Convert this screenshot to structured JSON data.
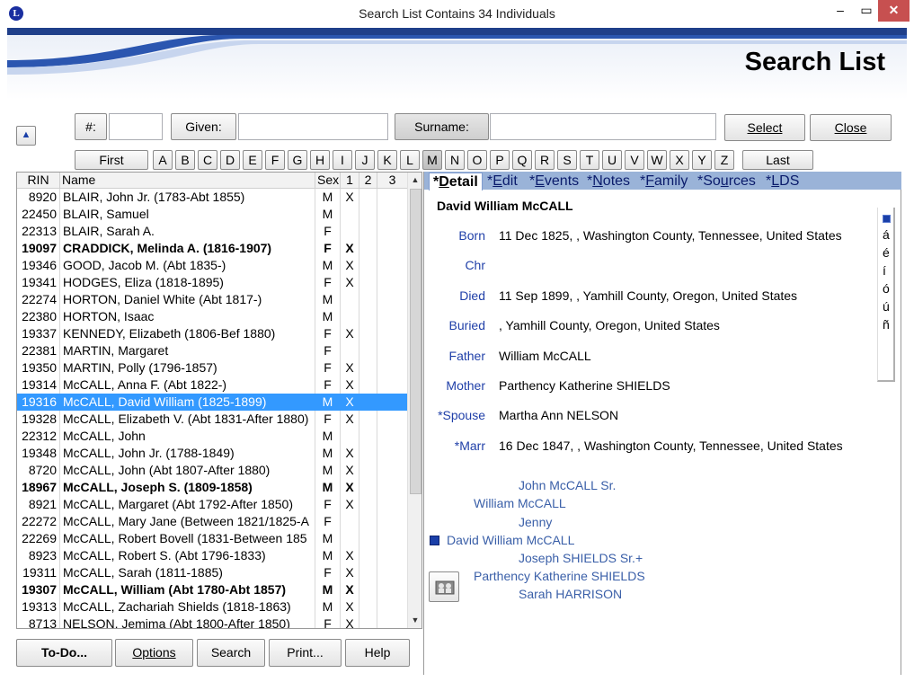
{
  "window": {
    "title": "Search List Contains 34 Individuals",
    "app_icon_letter": "L",
    "minimize_glyph": "–",
    "maximize_glyph": "▭",
    "close_glyph": "✕"
  },
  "header": {
    "title": "Search List"
  },
  "search": {
    "scroll_up_glyph": "▲",
    "num_label": "#:",
    "num_value": "",
    "given_label": "Given:",
    "given_value": "",
    "surname_label": "Surname:",
    "surname_value": "",
    "select_label": "Select",
    "close_label": "Close"
  },
  "alphabet": {
    "first_label": "First",
    "last_label": "Last",
    "letters": [
      "A",
      "B",
      "C",
      "D",
      "E",
      "F",
      "G",
      "H",
      "I",
      "J",
      "K",
      "L",
      "M",
      "N",
      "O",
      "P",
      "Q",
      "R",
      "S",
      "T",
      "U",
      "V",
      "W",
      "X",
      "Y",
      "Z"
    ],
    "active_letter": "M"
  },
  "list": {
    "columns": [
      "RIN",
      "Name",
      "Sex",
      "1",
      "2",
      "3"
    ],
    "rows": [
      {
        "rin": "8920",
        "name": "BLAIR, John Jr. (1783-Abt 1855)",
        "sex": "M",
        "c1": "X",
        "c2": "",
        "c3": "",
        "bold": false,
        "selected": false
      },
      {
        "rin": "22450",
        "name": "BLAIR, Samuel",
        "sex": "M",
        "c1": "",
        "c2": "",
        "c3": "",
        "bold": false,
        "selected": false
      },
      {
        "rin": "22313",
        "name": "BLAIR, Sarah A.",
        "sex": "F",
        "c1": "",
        "c2": "",
        "c3": "",
        "bold": false,
        "selected": false
      },
      {
        "rin": "19097",
        "name": "CRADDICK, Melinda A. (1816-1907)",
        "sex": "F",
        "c1": "X",
        "c2": "",
        "c3": "",
        "bold": true,
        "selected": false
      },
      {
        "rin": "19346",
        "name": "GOOD, Jacob M. (Abt 1835-)",
        "sex": "M",
        "c1": "X",
        "c2": "",
        "c3": "",
        "bold": false,
        "selected": false
      },
      {
        "rin": "19341",
        "name": "HODGES, Eliza (1818-1895)",
        "sex": "F",
        "c1": "X",
        "c2": "",
        "c3": "",
        "bold": false,
        "selected": false
      },
      {
        "rin": "22274",
        "name": "HORTON, Daniel White (Abt 1817-)",
        "sex": "M",
        "c1": "",
        "c2": "",
        "c3": "",
        "bold": false,
        "selected": false
      },
      {
        "rin": "22380",
        "name": "HORTON, Isaac",
        "sex": "M",
        "c1": "",
        "c2": "",
        "c3": "",
        "bold": false,
        "selected": false
      },
      {
        "rin": "19337",
        "name": "KENNEDY, Elizabeth (1806-Bef 1880)",
        "sex": "F",
        "c1": "X",
        "c2": "",
        "c3": "",
        "bold": false,
        "selected": false
      },
      {
        "rin": "22381",
        "name": "MARTIN, Margaret",
        "sex": "F",
        "c1": "",
        "c2": "",
        "c3": "",
        "bold": false,
        "selected": false
      },
      {
        "rin": "19350",
        "name": "MARTIN, Polly (1796-1857)",
        "sex": "F",
        "c1": "X",
        "c2": "",
        "c3": "",
        "bold": false,
        "selected": false
      },
      {
        "rin": "19314",
        "name": "McCALL, Anna F. (Abt 1822-)",
        "sex": "F",
        "c1": "X",
        "c2": "",
        "c3": "",
        "bold": false,
        "selected": false
      },
      {
        "rin": "19316",
        "name": "McCALL, David William (1825-1899)",
        "sex": "M",
        "c1": "X",
        "c2": "",
        "c3": "",
        "bold": false,
        "selected": true
      },
      {
        "rin": "19328",
        "name": "McCALL, Elizabeth V. (Abt 1831-After 1880)",
        "sex": "F",
        "c1": "X",
        "c2": "",
        "c3": "",
        "bold": false,
        "selected": false
      },
      {
        "rin": "22312",
        "name": "McCALL, John",
        "sex": "M",
        "c1": "",
        "c2": "",
        "c3": "",
        "bold": false,
        "selected": false
      },
      {
        "rin": "19348",
        "name": "McCALL, John Jr. (1788-1849)",
        "sex": "M",
        "c1": "X",
        "c2": "",
        "c3": "",
        "bold": false,
        "selected": false
      },
      {
        "rin": "8720",
        "name": "McCALL, John (Abt 1807-After 1880)",
        "sex": "M",
        "c1": "X",
        "c2": "",
        "c3": "",
        "bold": false,
        "selected": false
      },
      {
        "rin": "18967",
        "name": "McCALL, Joseph S. (1809-1858)",
        "sex": "M",
        "c1": "X",
        "c2": "",
        "c3": "",
        "bold": true,
        "selected": false
      },
      {
        "rin": "8921",
        "name": "McCALL, Margaret (Abt 1792-After 1850)",
        "sex": "F",
        "c1": "X",
        "c2": "",
        "c3": "",
        "bold": false,
        "selected": false
      },
      {
        "rin": "22272",
        "name": "McCALL, Mary Jane (Between 1821/1825-A",
        "sex": "F",
        "c1": "",
        "c2": "",
        "c3": "",
        "bold": false,
        "selected": false
      },
      {
        "rin": "22269",
        "name": "McCALL, Robert Bovell (1831-Between 185",
        "sex": "M",
        "c1": "",
        "c2": "",
        "c3": "",
        "bold": false,
        "selected": false
      },
      {
        "rin": "8923",
        "name": "McCALL, Robert S. (Abt 1796-1833)",
        "sex": "M",
        "c1": "X",
        "c2": "",
        "c3": "",
        "bold": false,
        "selected": false
      },
      {
        "rin": "19311",
        "name": "McCALL, Sarah (1811-1885)",
        "sex": "F",
        "c1": "X",
        "c2": "",
        "c3": "",
        "bold": false,
        "selected": false
      },
      {
        "rin": "19307",
        "name": "McCALL, William (Abt 1780-Abt 1857)",
        "sex": "M",
        "c1": "X",
        "c2": "",
        "c3": "",
        "bold": true,
        "selected": false
      },
      {
        "rin": "19313",
        "name": "McCALL, Zachariah Shields (1818-1863)",
        "sex": "M",
        "c1": "X",
        "c2": "",
        "c3": "",
        "bold": false,
        "selected": false
      },
      {
        "rin": "8713",
        "name": "NELSON, Jemima (Abt 1800-After 1850)",
        "sex": "F",
        "c1": "X",
        "c2": "",
        "c3": "",
        "bold": false,
        "selected": false
      }
    ],
    "scroll_up_glyph": "▲",
    "scroll_down_glyph": "▼"
  },
  "bottom_buttons": {
    "todo": "To-Do...",
    "options": "Options",
    "search": "Search",
    "print": "Print...",
    "help": "Help"
  },
  "tabs": [
    {
      "prefix": "*",
      "key": "D",
      "rest": "etail",
      "active": true
    },
    {
      "prefix": "*",
      "key": "E",
      "rest": "dit",
      "active": false
    },
    {
      "prefix": "*",
      "key": "E",
      "rest": "vents",
      "active": false
    },
    {
      "prefix": "*",
      "key": "N",
      "rest": "otes",
      "active": false
    },
    {
      "prefix": "*",
      "key": "F",
      "rest": "amily",
      "active": false
    },
    {
      "prefix": "*So",
      "key": "u",
      "rest": "rces",
      "active": false
    },
    {
      "prefix": "*",
      "key": "L",
      "rest": "DS",
      "active": false
    }
  ],
  "detail": {
    "person_name": "David William McCALL",
    "fields": [
      {
        "label": "Born",
        "value": "11 Dec 1825, , Washington County, Tennessee, United States"
      },
      {
        "label": "Chr",
        "value": ""
      },
      {
        "label": "Died",
        "value": "11 Sep 1899, , Yamhill County, Oregon, United States"
      },
      {
        "label": "Buried",
        "value": ", Yamhill County, Oregon, United States"
      },
      {
        "label": "Father",
        "value": "William McCALL"
      },
      {
        "label": "Mother",
        "value": "Parthency Katherine SHIELDS"
      },
      {
        "label": "*Spouse",
        "value": "Martha Ann NELSON"
      },
      {
        "label": "*Marr",
        "value": "16 Dec 1847, , Washington County, Tennessee, United States"
      }
    ],
    "special_chars": [
      "á",
      "é",
      "í",
      "ó",
      "ú",
      "ñ"
    ]
  },
  "pedigree": {
    "paternal_grandfather": "John McCALL Sr.",
    "father": "William McCALL",
    "paternal_grandmother": "Jenny",
    "subject": "David William McCALL",
    "maternal_grandfather": "Joseph SHIELDS Sr.+",
    "mother": "Parthency Katherine SHIELDS",
    "maternal_grandmother": "Sarah HARRISON"
  },
  "colors": {
    "selection": "#3399ff",
    "label_blue": "#1f3fa8",
    "pedigree_blue": "#3a5fa8",
    "tab_strip": "#9ab3d8",
    "header_stripe": "#1f3f8a"
  }
}
